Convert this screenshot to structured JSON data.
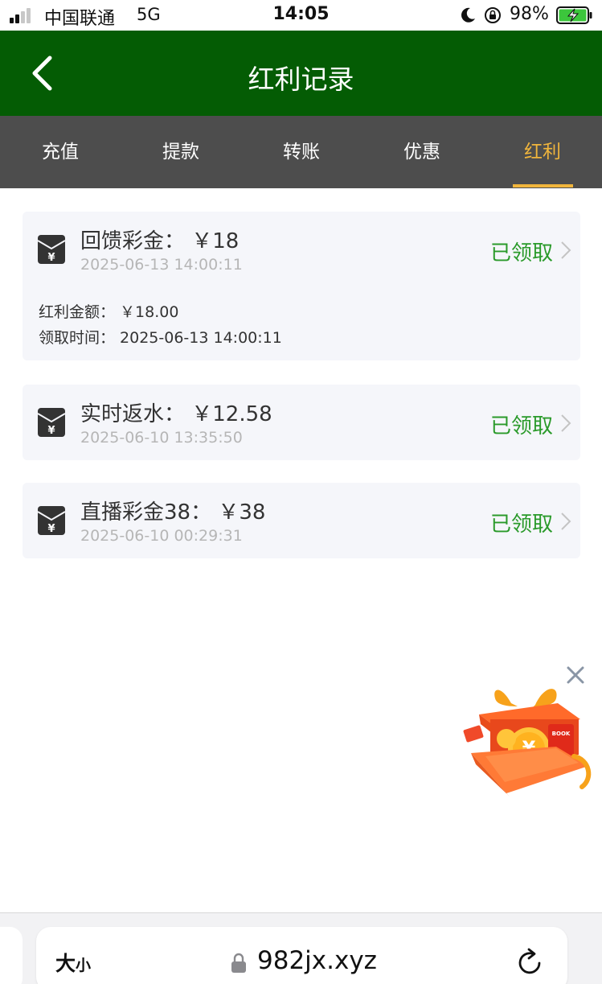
{
  "status_bar": {
    "carrier": "中国联通",
    "network": "5G",
    "time": "14:05",
    "battery": "98%"
  },
  "header": {
    "title": "红利记录",
    "back_icon": "chevron-left-icon"
  },
  "tabs": [
    {
      "label": "充值",
      "active": false
    },
    {
      "label": "提款",
      "active": false
    },
    {
      "label": "转账",
      "active": false
    },
    {
      "label": "优惠",
      "active": false
    },
    {
      "label": "红利",
      "active": true
    }
  ],
  "records": [
    {
      "title": "回馈彩金： ￥18",
      "time": "2025-06-13 14:00:11",
      "status": "已领取",
      "expanded": true,
      "details": [
        "红利金额： ￥18.00",
        "领取时间： 2025-06-13 14:00:11"
      ]
    },
    {
      "title": "实时返水： ￥12.58",
      "time": "2025-06-10 13:35:50",
      "status": "已领取",
      "expanded": false
    },
    {
      "title": "直播彩金38： ￥38",
      "time": "2025-06-10 00:29:31",
      "status": "已领取",
      "expanded": false
    }
  ],
  "floating_promo": {
    "icon": "gift-box-icon",
    "close_icon": "close-icon",
    "badge_text": "BOOK"
  },
  "browser": {
    "text_size_big": "大",
    "text_size_small": "小",
    "url": "982jx.xyz",
    "lock_icon": "lock-icon",
    "reload_icon": "reload-icon"
  },
  "colors": {
    "header_bg": "#045c04",
    "tab_bg": "#4d4d4d",
    "tab_active": "#f0b53c",
    "status_green": "#2a9a2a",
    "card_bg": "#f5f6fa"
  }
}
